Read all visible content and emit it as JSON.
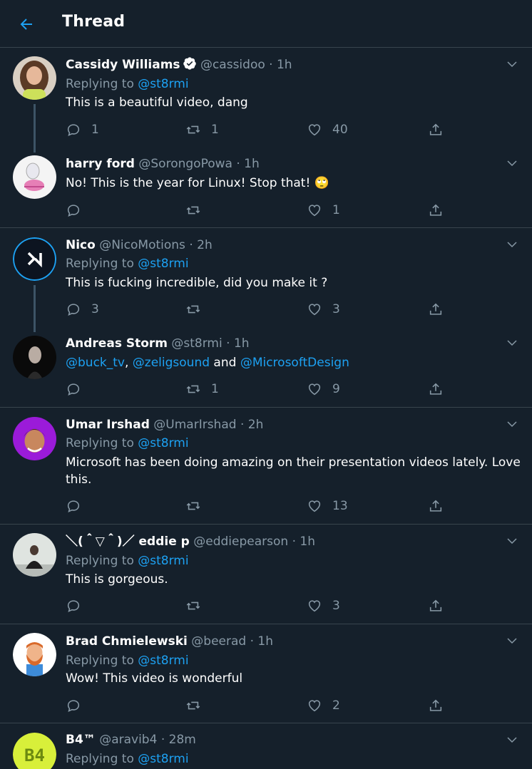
{
  "header": {
    "title": "Thread"
  },
  "common": {
    "replying_to_prefix": "Replying to",
    "dot": "·"
  },
  "tweets": [
    {
      "name": "Cassidy Williams",
      "handle": "@cassidoo",
      "time": "1h",
      "replying_to": "@st8rmi",
      "text": "This is a beautiful video, dang",
      "replies": "1",
      "retweets": "1",
      "likes": "40",
      "verified": true
    },
    {
      "name": "harry ford",
      "handle": "@SorongoPowa",
      "time": "1h",
      "text": "No! This is the year for Linux! Stop that!",
      "emoji": "🙄",
      "replies": "",
      "retweets": "",
      "likes": "1"
    },
    {
      "name": "Nico",
      "handle": "@NicoMotions",
      "time": "2h",
      "replying_to": "@st8rmi",
      "text": "This is fucking incredible, did you make it ?",
      "replies": "3",
      "retweets": "",
      "likes": "3"
    },
    {
      "name": "Andreas Storm",
      "handle": "@st8rmi",
      "time": "1h",
      "mention1": "@buck_tv",
      "sep1": ",",
      "mention2": "@zeligsound",
      "sep2": "and",
      "mention3": "@MicrosoftDesign",
      "replies": "",
      "retweets": "1",
      "likes": "9"
    },
    {
      "name": "Umar Irshad",
      "handle": "@UmarIrshad",
      "time": "2h",
      "replying_to": "@st8rmi",
      "text": "Microsoft has been doing amazing on their presentation videos lately. Love this.",
      "replies": "",
      "retweets": "",
      "likes": "13"
    },
    {
      "name": "＼(＾▽＾)／ eddie p",
      "handle": "@eddiepearson",
      "time": "1h",
      "replying_to": "@st8rmi",
      "text": "This is gorgeous.",
      "replies": "",
      "retweets": "",
      "likes": "3"
    },
    {
      "name": "Brad Chmielewski",
      "handle": "@beerad",
      "time": "1h",
      "replying_to": "@st8rmi",
      "text": "Wow! This video is wonderful",
      "replies": "",
      "retweets": "",
      "likes": "2"
    },
    {
      "name": "B4™",
      "handle": "@aravib4",
      "time": "28m",
      "replying_to": "@st8rmi"
    }
  ],
  "colors": {
    "background": "#15202b",
    "accent": "#1da1f2",
    "muted": "#8899a6",
    "divider": "#38444d"
  }
}
